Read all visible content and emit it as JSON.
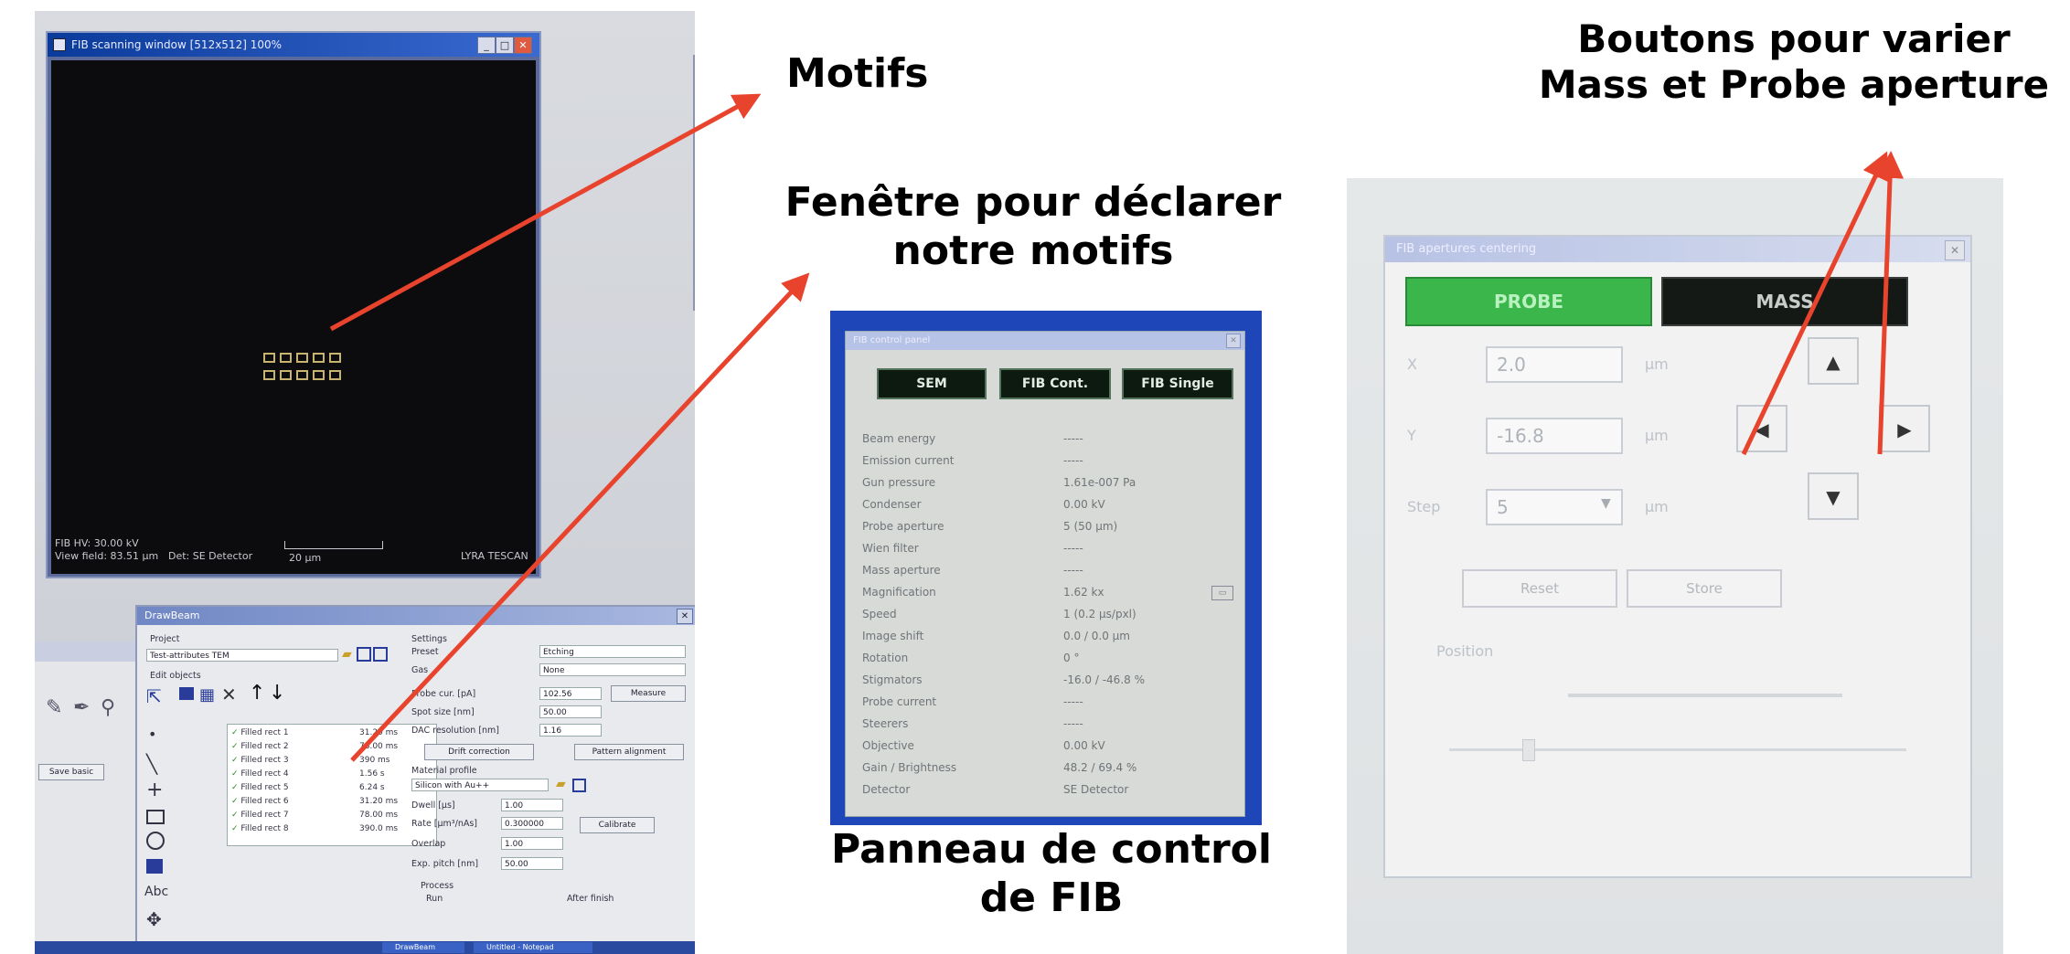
{
  "captions": {
    "motifs": "Motifs",
    "fenetre_line1": "Fenêtre pour déclarer",
    "fenetre_line2": "notre motifs",
    "panneau_line1": "Panneau de control",
    "panneau_line2": "de FIB",
    "boutons_line1": "Boutons pour varier",
    "boutons_line2": "Mass et Probe aperture"
  },
  "colors": {
    "arrow": "#e8432d",
    "probe_green": "#3bb64a",
    "screen_blue": "#1e46b8"
  },
  "fib_scanning_window": {
    "title": "FIB scanning window [512x512] 100%",
    "info_line1": "FIB HV: 30.00 kV",
    "info_line2": "View field: 83.51 µm",
    "detector": "Det: SE Detector",
    "scale": "20 µm",
    "brand": "LYRA TESCAN",
    "motif_rows": 2,
    "motif_cols": 5
  },
  "left_side_panel": {
    "save_button": "Save basic"
  },
  "draw_tool": {
    "title": "DrawBeam",
    "project_label": "Project",
    "project_value": "Test-attributes TEM",
    "edit_objects_label": "Edit objects",
    "settings_label": "Settings",
    "preset_label": "Preset",
    "preset_value": "Etching",
    "gas_label": "Gas",
    "gas_value": "None",
    "probe_label": "Probe cur. [pA]",
    "probe_value": "102.56",
    "measure_button": "Measure",
    "spot_label": "Spot size [nm]",
    "spot_value": "50.00",
    "dac_label": "DAC resolution [nm]",
    "dac_value": "1.16",
    "drift_button": "Drift correction",
    "pattern_button": "Pattern alignment",
    "material_label": "Material profile",
    "material_value": "Silicon with Au++",
    "dwell_label": "Dwell [µs]",
    "dwell_value": "1.00",
    "rate_label": "Rate [µm³/nAs]",
    "rate_value": "0.300000",
    "calibrate_button": "Calibrate",
    "overlap_label": "Overlap",
    "overlap_value": "1.00",
    "exp_label": "Exp. pitch [nm]",
    "exp_value": "50.00",
    "process_label": "Process",
    "run_label": "Run",
    "after_label": "After finish",
    "objects": [
      {
        "name": "Filled rect 1",
        "value": "31.20 ms"
      },
      {
        "name": "Filled rect 2",
        "value": "78.00 ms"
      },
      {
        "name": "Filled rect 3",
        "value": "390 ms"
      },
      {
        "name": "Filled rect 4",
        "value": "1.56 s"
      },
      {
        "name": "Filled rect 5",
        "value": "6.24 s"
      },
      {
        "name": "Filled rect 6",
        "value": "31.20 ms"
      },
      {
        "name": "Filled rect 7",
        "value": "78.00 ms"
      },
      {
        "name": "Filled rect 8",
        "value": "390.0 ms"
      }
    ]
  },
  "taskbar": {
    "item1": "DrawBeam",
    "item2": "Untitled - Notepad"
  },
  "fib_control_panel": {
    "title": "FIB control panel",
    "mode_sem": "SEM",
    "mode_fib_cont": "FIB Cont.",
    "mode_fib_single": "FIB Single",
    "params": [
      {
        "label": "Beam energy",
        "value": "-----"
      },
      {
        "label": "Emission current",
        "value": "-----"
      },
      {
        "label": "Gun pressure",
        "value": "1.61e-007 Pa"
      },
      {
        "label": "Condenser",
        "value": "0.00 kV"
      },
      {
        "label": "Probe aperture",
        "value": "5 (50 µm)"
      },
      {
        "label": "Wien filter",
        "value": "-----"
      },
      {
        "label": "Mass aperture",
        "value": "-----"
      },
      {
        "label": "Magnification",
        "value": "1.62 kx"
      },
      {
        "label": "Speed",
        "value": "1 (0.2 µs/pxl)"
      },
      {
        "label": "Image shift",
        "value": "0.0 / 0.0 µm"
      },
      {
        "label": "Rotation",
        "value": "0 °"
      },
      {
        "label": "Stigmators",
        "value": "-16.0 / -46.8 %"
      },
      {
        "label": "Probe current",
        "value": "-----"
      },
      {
        "label": "Steerers",
        "value": "-----"
      },
      {
        "label": "Objective",
        "value": "0.00 kV"
      },
      {
        "label": "Gain / Brightness",
        "value": "48.2 / 69.4 %"
      },
      {
        "label": "Detector",
        "value": "SE Detector"
      }
    ]
  },
  "aperture_window": {
    "title": "FIB apertures centering",
    "probe_button": "PROBE",
    "mass_button": "MASS",
    "x_label": "X",
    "x_value": "2.0",
    "y_label": "Y",
    "y_value": "-16.8",
    "step_label": "Step",
    "step_value": "5",
    "unit": "µm",
    "btn_up": "▲",
    "btn_left": "◀",
    "btn_right": "▶",
    "btn_down": "▼",
    "reset_button": "Reset",
    "store_button": "Store",
    "position_label": "Position"
  }
}
